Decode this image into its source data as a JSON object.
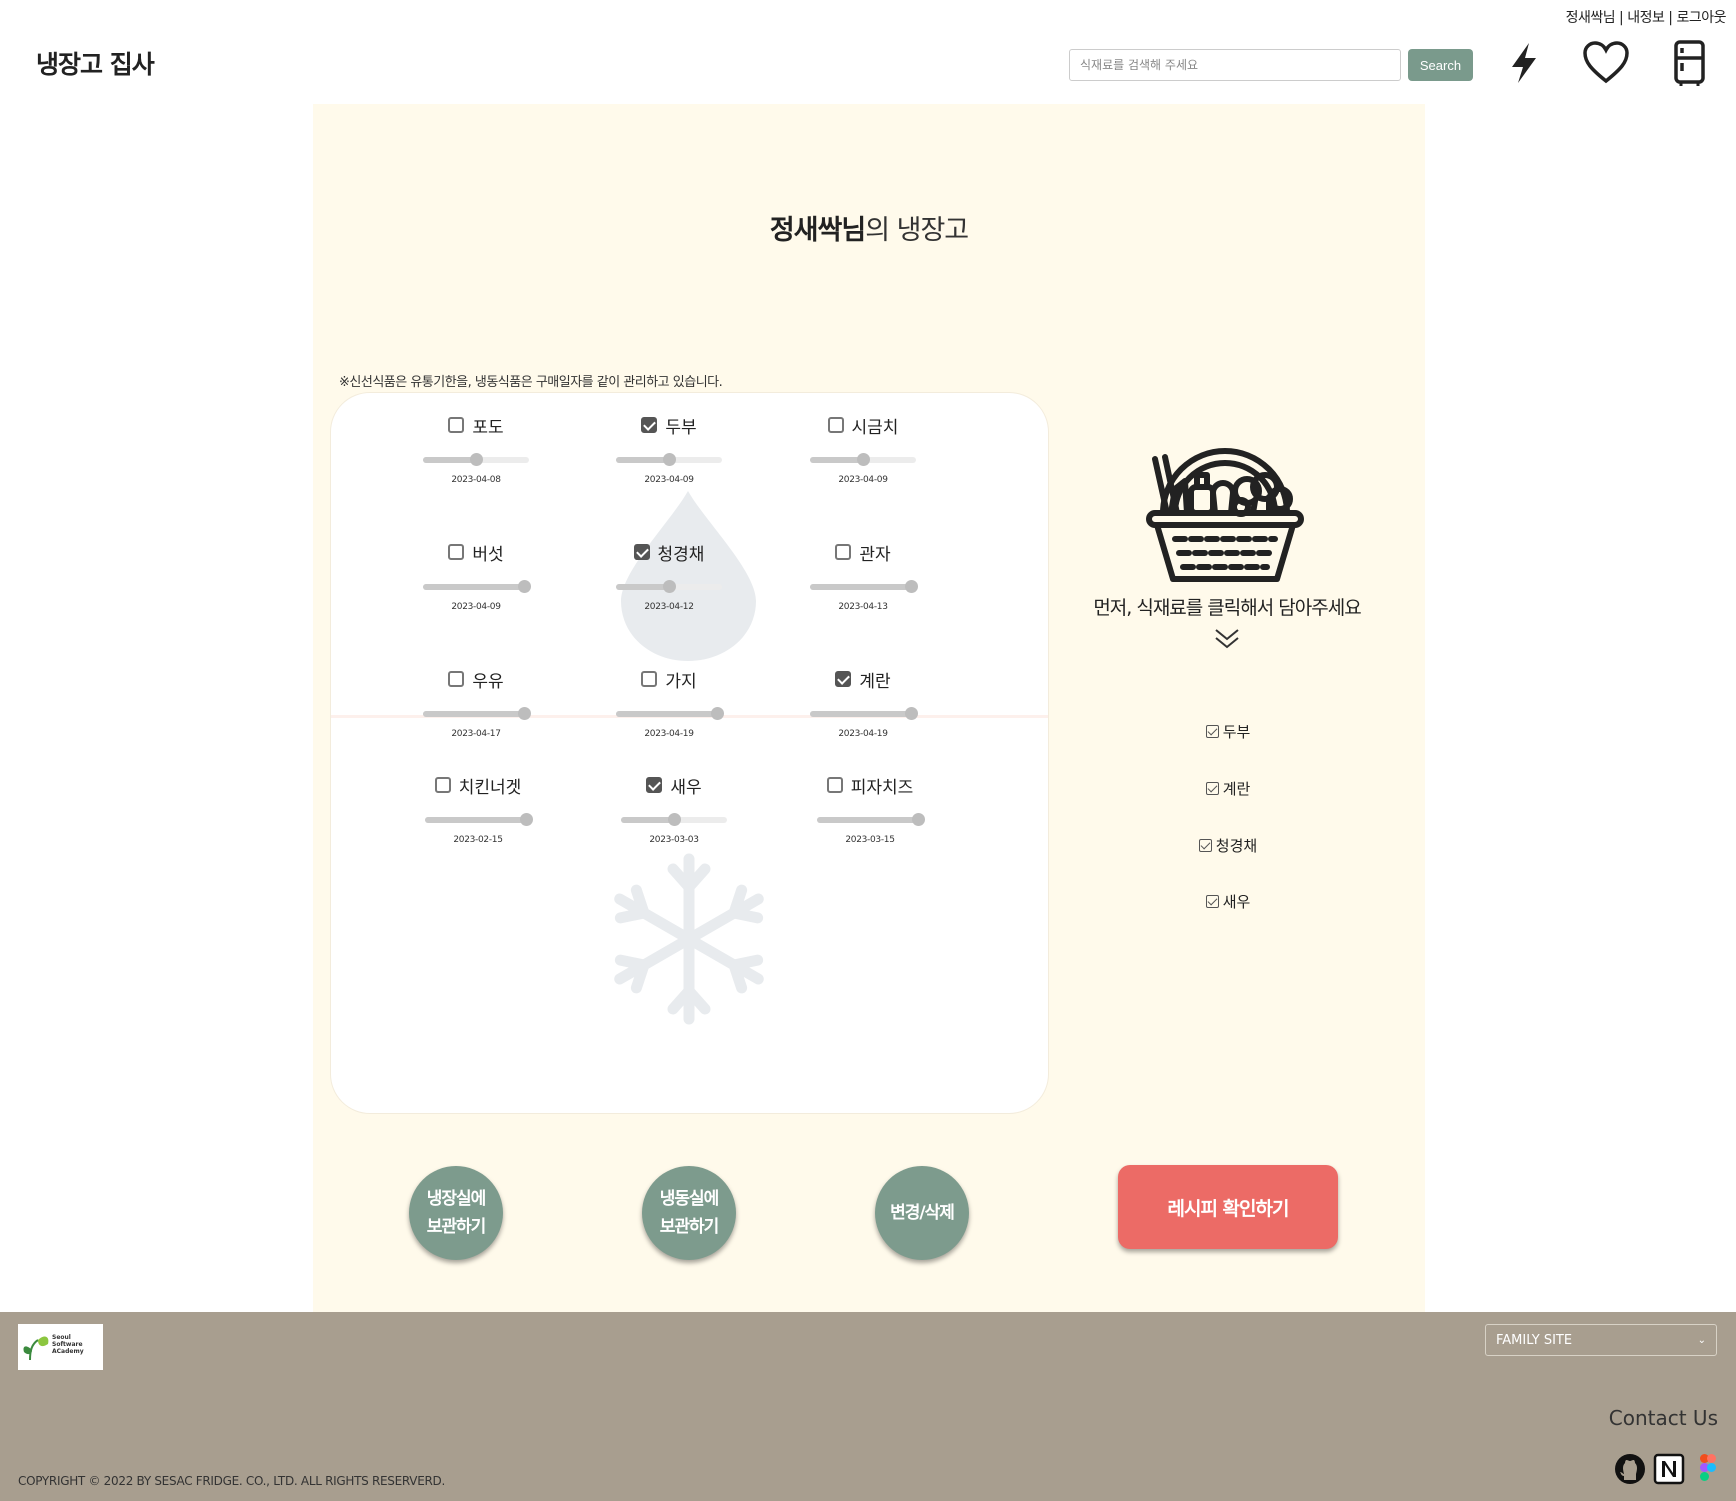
{
  "header": {
    "user_links": "정새싹님 | 내정보 | 로그아웃",
    "logo": "냉장고 집사",
    "search_placeholder": "식재료를 검색해 주세요",
    "search_button": "Search",
    "icons": [
      "lightning-icon",
      "heart-icon",
      "fridge-icon"
    ]
  },
  "main": {
    "title_bold": "정새싹님",
    "title_rest": "의 냉장고",
    "notice": "※신선식품은 유통기한을, 냉동식품은 구매일자를 같이 관리하고 있습니다.",
    "fridge_items": [
      {
        "name": "포도",
        "checked": false,
        "date": "2023-04-08",
        "level": 0.5
      },
      {
        "name": "두부",
        "checked": true,
        "date": "2023-04-09",
        "level": 0.5
      },
      {
        "name": "시금치",
        "checked": false,
        "date": "2023-04-09",
        "level": 0.5
      },
      {
        "name": "버섯",
        "checked": false,
        "date": "2023-04-09",
        "level": 0.95
      },
      {
        "name": "청경채",
        "checked": true,
        "date": "2023-04-12",
        "level": 0.5
      },
      {
        "name": "관자",
        "checked": false,
        "date": "2023-04-13",
        "level": 0.95
      },
      {
        "name": "우유",
        "checked": false,
        "date": "2023-04-17",
        "level": 0.95
      },
      {
        "name": "가지",
        "checked": false,
        "date": "2023-04-19",
        "level": 0.95
      },
      {
        "name": "계란",
        "checked": true,
        "date": "2023-04-19",
        "level": 0.95
      }
    ],
    "freezer_items": [
      {
        "name": "치킨너겟",
        "checked": false,
        "date": "2023-02-15",
        "level": 0.95
      },
      {
        "name": "새우",
        "checked": true,
        "date": "2023-03-03",
        "level": 0.5
      },
      {
        "name": "피자치즈",
        "checked": false,
        "date": "2023-03-15",
        "level": 0.95
      }
    ],
    "basket_message": "먼저, 식재료를 클릭해서 담아주세요",
    "selected": [
      "두부",
      "계란",
      "청경채",
      "새우"
    ],
    "buttons": {
      "fridge_store": "냉장실에\n보관하기",
      "freezer_store": "냉동실에\n보관하기",
      "edit_delete": "변경/삭제",
      "recipe": "레시피 확인하기"
    }
  },
  "footer": {
    "logo_text": "Seoul Software ACademy",
    "family_site": "FAMILY SITE",
    "contact": "Contact Us",
    "copyright": "COPYRIGHT © 2022 BY SESAC FRIDGE. CO., LTD. ALL RIGHTS RESERVERD."
  },
  "colors": {
    "panel_bg": "#fffaeb",
    "green_button": "#7d9b8d",
    "recipe_button": "#ec6b66",
    "footer_bg": "#a89e8f"
  }
}
